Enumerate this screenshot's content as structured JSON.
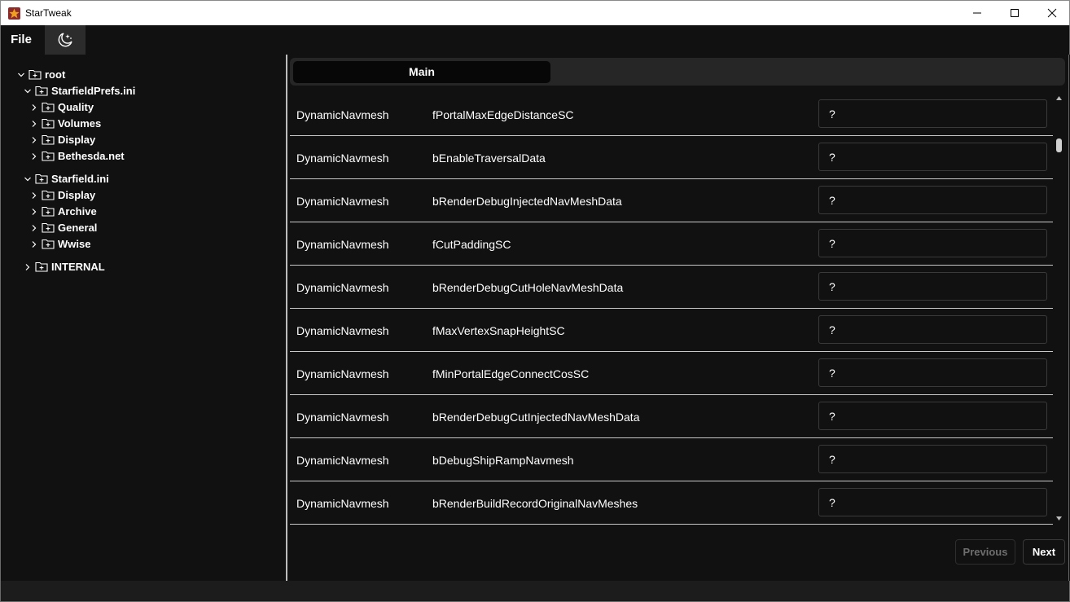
{
  "window": {
    "title": "StarTweak"
  },
  "menu": {
    "file_label": "File",
    "theme_icon": "moon-sparkle-icon"
  },
  "tree": [
    {
      "label": "root",
      "expanded": true
    },
    {
      "label": "StarfieldPrefs.ini",
      "expanded": true
    },
    {
      "label": "Quality",
      "expanded": false
    },
    {
      "label": "Volumes",
      "expanded": false
    },
    {
      "label": "Display",
      "expanded": false
    },
    {
      "label": "Bethesda.net",
      "expanded": false
    },
    {
      "label": "Starfield.ini",
      "expanded": true
    },
    {
      "label": "Display",
      "expanded": false
    },
    {
      "label": "Archive",
      "expanded": false
    },
    {
      "label": "General",
      "expanded": false
    },
    {
      "label": "Wwise",
      "expanded": false
    },
    {
      "label": "INTERNAL",
      "expanded": false
    }
  ],
  "tabs": {
    "main_label": "Main"
  },
  "rows": [
    {
      "section": "DynamicNavmesh",
      "key": "fPortalMaxEdgeDistanceSC",
      "value": "?"
    },
    {
      "section": "DynamicNavmesh",
      "key": "bEnableTraversalData",
      "value": "?"
    },
    {
      "section": "DynamicNavmesh",
      "key": "bRenderDebugInjectedNavMeshData",
      "value": "?"
    },
    {
      "section": "DynamicNavmesh",
      "key": "fCutPaddingSC",
      "value": "?"
    },
    {
      "section": "DynamicNavmesh",
      "key": "bRenderDebugCutHoleNavMeshData",
      "value": "?"
    },
    {
      "section": "DynamicNavmesh",
      "key": "fMaxVertexSnapHeightSC",
      "value": "?"
    },
    {
      "section": "DynamicNavmesh",
      "key": "fMinPortalEdgeConnectCosSC",
      "value": "?"
    },
    {
      "section": "DynamicNavmesh",
      "key": "bRenderDebugCutInjectedNavMeshData",
      "value": "?"
    },
    {
      "section": "DynamicNavmesh",
      "key": "bDebugShipRampNavmesh",
      "value": "?"
    },
    {
      "section": "DynamicNavmesh",
      "key": "bRenderBuildRecordOriginalNavMeshes",
      "value": "?"
    }
  ],
  "pagination": {
    "previous_label": "Previous",
    "next_label": "Next",
    "previous_disabled": true
  },
  "colors": {
    "background": "#111111",
    "text": "#ffffff",
    "divider": "#c8c8c8",
    "tab_active": "#070707",
    "app_icon": "#8b2b2b"
  }
}
